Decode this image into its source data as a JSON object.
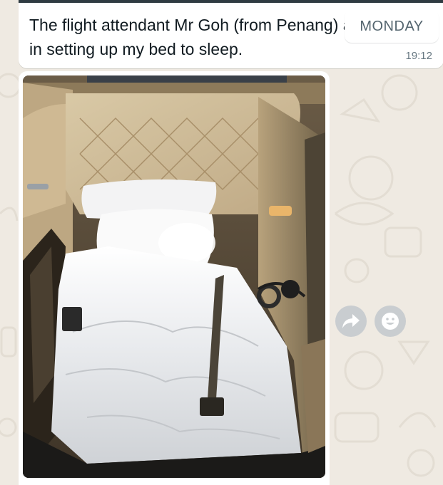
{
  "chat": {
    "date_chip": "MONDAY",
    "message": {
      "text": "The flight attendant Mr Goh (from Penang) assisted me in setting up my bed to sleep.",
      "time": "19:12"
    }
  },
  "actions": {
    "forward_icon": "forward-arrow",
    "reaction_icon": "smiley-face"
  },
  "colors": {
    "wallpaper": "#efeae2",
    "bubble": "#ffffff",
    "text": "#111b21",
    "meta": "#667781",
    "action_button": "#c9cdd0"
  }
}
